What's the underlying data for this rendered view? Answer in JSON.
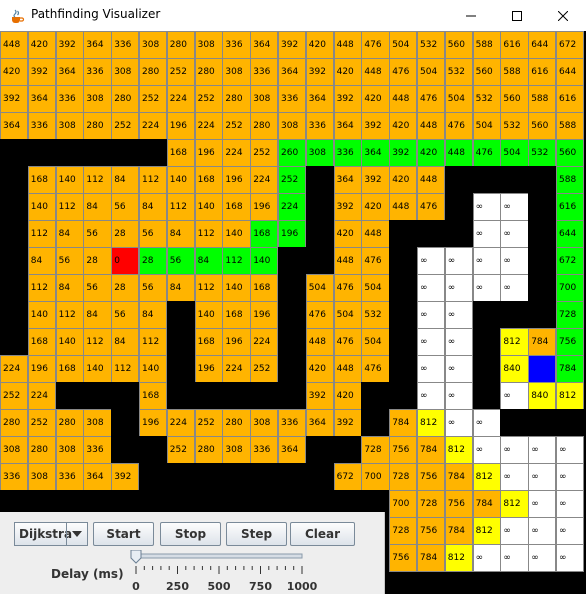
{
  "window": {
    "title": "Pathfinding Visualizer",
    "icon": "java-cup-icon",
    "buttons": [
      "minimize-icon",
      "maximize-icon",
      "close-icon"
    ]
  },
  "colors": {
    "wall": "#000000",
    "visited": "#ffb400",
    "path": "#00ff00",
    "frontier": "#ffff00",
    "unvisited": "#ffffff",
    "start": "#ff0000",
    "end": "#0000ff"
  },
  "grid": {
    "rows": [
      [
        "448",
        "420",
        "392",
        "364",
        "336",
        "308",
        "280",
        "308",
        "336",
        "364",
        "392",
        "420",
        "448",
        "476",
        "504",
        "532",
        "560",
        "588",
        "616",
        "644",
        "672"
      ],
      [
        "420",
        "392",
        "364",
        "336",
        "308",
        "280",
        "252",
        "280",
        "308",
        "336",
        "364",
        "392",
        "420",
        "448",
        "476",
        "504",
        "532",
        "560",
        "588",
        "616",
        "644"
      ],
      [
        "392",
        "364",
        "336",
        "308",
        "280",
        "252",
        "224",
        "252",
        "280",
        "308",
        "336",
        "364",
        "392",
        "420",
        "448",
        "476",
        "504",
        "532",
        "560",
        "588",
        "616"
      ],
      [
        "364",
        "336",
        "308",
        "280",
        "252",
        "224",
        "196",
        "224",
        "252",
        "280",
        "308",
        "336",
        "364",
        "392",
        "420",
        "448",
        "476",
        "504",
        "532",
        "560",
        "588"
      ],
      [
        "#",
        "#",
        "#",
        "#",
        "#",
        "#",
        "168",
        "196",
        "224",
        "252",
        "P260",
        "P308",
        "P336",
        "P364",
        "P392",
        "P420",
        "P448",
        "P476",
        "P504",
        "P532",
        "P560"
      ],
      [
        "#",
        "168",
        "140",
        "112",
        "84",
        "112",
        "140",
        "168",
        "196",
        "224",
        "P252",
        "#",
        "364",
        "392",
        "420",
        "448",
        "#",
        "#",
        "#",
        "#",
        "P588"
      ],
      [
        "#",
        "140",
        "112",
        "84",
        "56",
        "84",
        "112",
        "140",
        "168",
        "196",
        "P224",
        "#",
        "392",
        "420",
        "448",
        "476",
        "#",
        "W∞",
        "W∞",
        "#",
        "P616"
      ],
      [
        "#",
        "112",
        "84",
        "56",
        "28",
        "56",
        "84",
        "112",
        "140",
        "P168",
        "P196",
        "#",
        "420",
        "448",
        "#",
        "#",
        "#",
        "W∞",
        "W∞",
        "#",
        "P644"
      ],
      [
        "#",
        "84",
        "56",
        "28",
        "S0",
        "P28",
        "P56",
        "P84",
        "P112",
        "P140",
        "#",
        "#",
        "448",
        "476",
        "#",
        "W∞",
        "W∞",
        "W∞",
        "W∞",
        "#",
        "P672"
      ],
      [
        "#",
        "112",
        "84",
        "56",
        "28",
        "56",
        "84",
        "112",
        "140",
        "168",
        "#",
        "504",
        "476",
        "504",
        "#",
        "W∞",
        "W∞",
        "W∞",
        "W∞",
        "#",
        "P700"
      ],
      [
        "#",
        "140",
        "112",
        "84",
        "56",
        "84",
        "#",
        "140",
        "168",
        "196",
        "#",
        "476",
        "504",
        "532",
        "#",
        "W∞",
        "W∞",
        "#",
        "#",
        "#",
        "P728"
      ],
      [
        "#",
        "168",
        "140",
        "112",
        "84",
        "112",
        "#",
        "168",
        "196",
        "224",
        "#",
        "448",
        "476",
        "504",
        "#",
        "W∞",
        "W∞",
        "#",
        "F812",
        "784",
        "P756"
      ],
      [
        "224",
        "196",
        "168",
        "140",
        "112",
        "140",
        "#",
        "196",
        "224",
        "252",
        "#",
        "420",
        "448",
        "476",
        "#",
        "W∞",
        "W∞",
        "#",
        "F840",
        "E",
        "P784"
      ],
      [
        "252",
        "224",
        "#",
        "#",
        "#",
        "168",
        "#",
        "#",
        "#",
        "#",
        "#",
        "392",
        "420",
        "#",
        "#",
        "W∞",
        "W∞",
        "#",
        "W∞",
        "F840",
        "F812"
      ],
      [
        "280",
        "252",
        "280",
        "308",
        "#",
        "196",
        "224",
        "252",
        "280",
        "308",
        "336",
        "364",
        "392",
        "#",
        "784",
        "F812",
        "W∞",
        "W∞",
        "#",
        "#",
        "#"
      ],
      [
        "308",
        "280",
        "308",
        "336",
        "#",
        "#",
        "252",
        "280",
        "308",
        "336",
        "364",
        "#",
        "#",
        "728",
        "756",
        "784",
        "F812",
        "W∞",
        "W∞",
        "W∞",
        "W∞"
      ],
      [
        "336",
        "308",
        "336",
        "364",
        "392",
        "#",
        "#",
        "#",
        "#",
        "#",
        "#",
        "#",
        "672",
        "700",
        "728",
        "756",
        "784",
        "F812",
        "W∞",
        "W∞",
        "W∞"
      ],
      [
        "#",
        "#",
        "#",
        "#",
        "#",
        "#",
        "#",
        "#",
        "#",
        "#",
        "#",
        "#",
        "#",
        "#",
        "700",
        "728",
        "756",
        "784",
        "F812",
        "W∞",
        "W∞"
      ],
      [
        "#",
        "#",
        "#",
        "#",
        "#",
        "#",
        "#",
        "#",
        "#",
        "#",
        "#",
        "#",
        "#",
        "#",
        "728",
        "756",
        "784",
        "F812",
        "W∞",
        "W∞",
        "W∞"
      ],
      [
        "#",
        "#",
        "#",
        "#",
        "#",
        "#",
        "#",
        "#",
        "#",
        "#",
        "#",
        "#",
        "#",
        "#",
        "756",
        "784",
        "F812",
        "W∞",
        "W∞",
        "W∞",
        "W∞"
      ]
    ]
  },
  "controls": {
    "algorithm": "Dijkstra",
    "start_label": "Start",
    "stop_label": "Stop",
    "step_label": "Step",
    "clear_label": "Clear",
    "delay_label": "Delay (ms)",
    "delay_value": 0,
    "delay_min": 0,
    "delay_max": 1000,
    "delay_ticks": [
      "0",
      "250",
      "500",
      "750",
      "1000"
    ]
  }
}
